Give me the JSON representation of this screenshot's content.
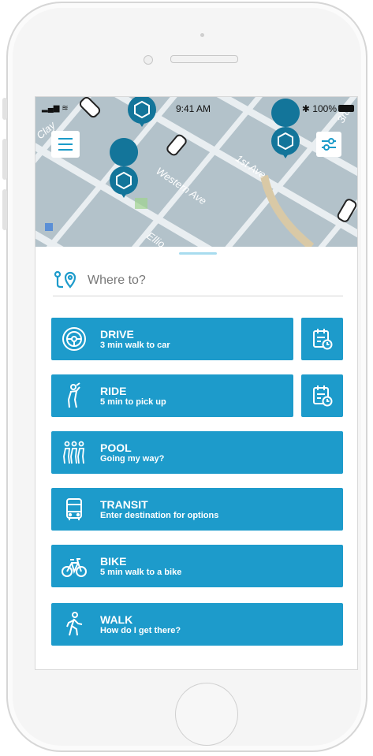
{
  "status_bar": {
    "time": "9:41 AM",
    "battery": "100%"
  },
  "map": {
    "labels": [
      "Western Ave",
      "1st Ave",
      "Clay",
      "Ellio",
      "3rd"
    ]
  },
  "search": {
    "placeholder": "Where to?"
  },
  "modes": [
    {
      "title": "DRIVE",
      "subtitle": "3 min walk to car",
      "icon": "steering-wheel-icon",
      "schedulable": true
    },
    {
      "title": "RIDE",
      "subtitle": "5 min to pick up",
      "icon": "person-hailing-icon",
      "schedulable": true
    },
    {
      "title": "POOL",
      "subtitle": "Going my way?",
      "icon": "group-people-icon",
      "schedulable": false
    },
    {
      "title": "TRANSIT",
      "subtitle": "Enter destination for options",
      "icon": "bus-icon",
      "schedulable": false
    },
    {
      "title": "BIKE",
      "subtitle": "5 min walk to a bike",
      "icon": "bicycle-icon",
      "schedulable": false
    },
    {
      "title": "WALK",
      "subtitle": "How do I get there?",
      "icon": "walking-person-icon",
      "schedulable": false
    }
  ],
  "colors": {
    "accent": "#1d9bcb",
    "map_base": "#b8c7cf",
    "pin": "#13759a"
  }
}
